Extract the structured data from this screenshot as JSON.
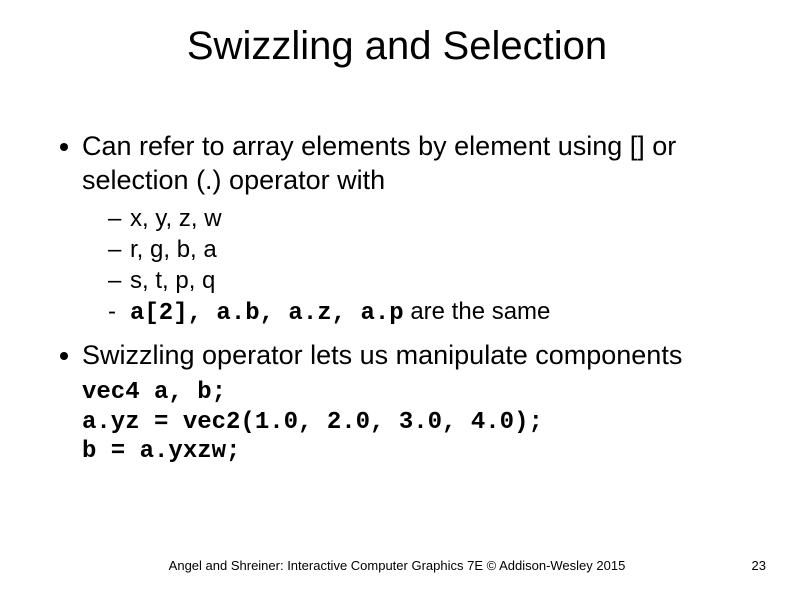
{
  "title": "Swizzling and Selection",
  "bullets": [
    {
      "text": "Can refer to array elements by element using [] or selection (.) operator with",
      "subs": [
        {
          "dash": "–",
          "text": "x, y, z, w",
          "mono": false
        },
        {
          "dash": "–",
          "text": "r, g, b, a",
          "mono": false
        },
        {
          "dash": "–",
          "text": "s, t, p, q",
          "mono": false
        },
        {
          "dash": "-",
          "code_prefix": "a[2], a.b, a.z, a.p",
          "suffix": " are the same"
        }
      ]
    },
    {
      "text": "Swizzling operator lets us manipulate components",
      "code": "vec4 a, b;\na.yz = vec2(1.0, 2.0, 3.0, 4.0);\nb = a.yxzw;"
    }
  ],
  "footer": "Angel and Shreiner: Interactive Computer Graphics 7E © Addison-Wesley 2015",
  "page": "23"
}
